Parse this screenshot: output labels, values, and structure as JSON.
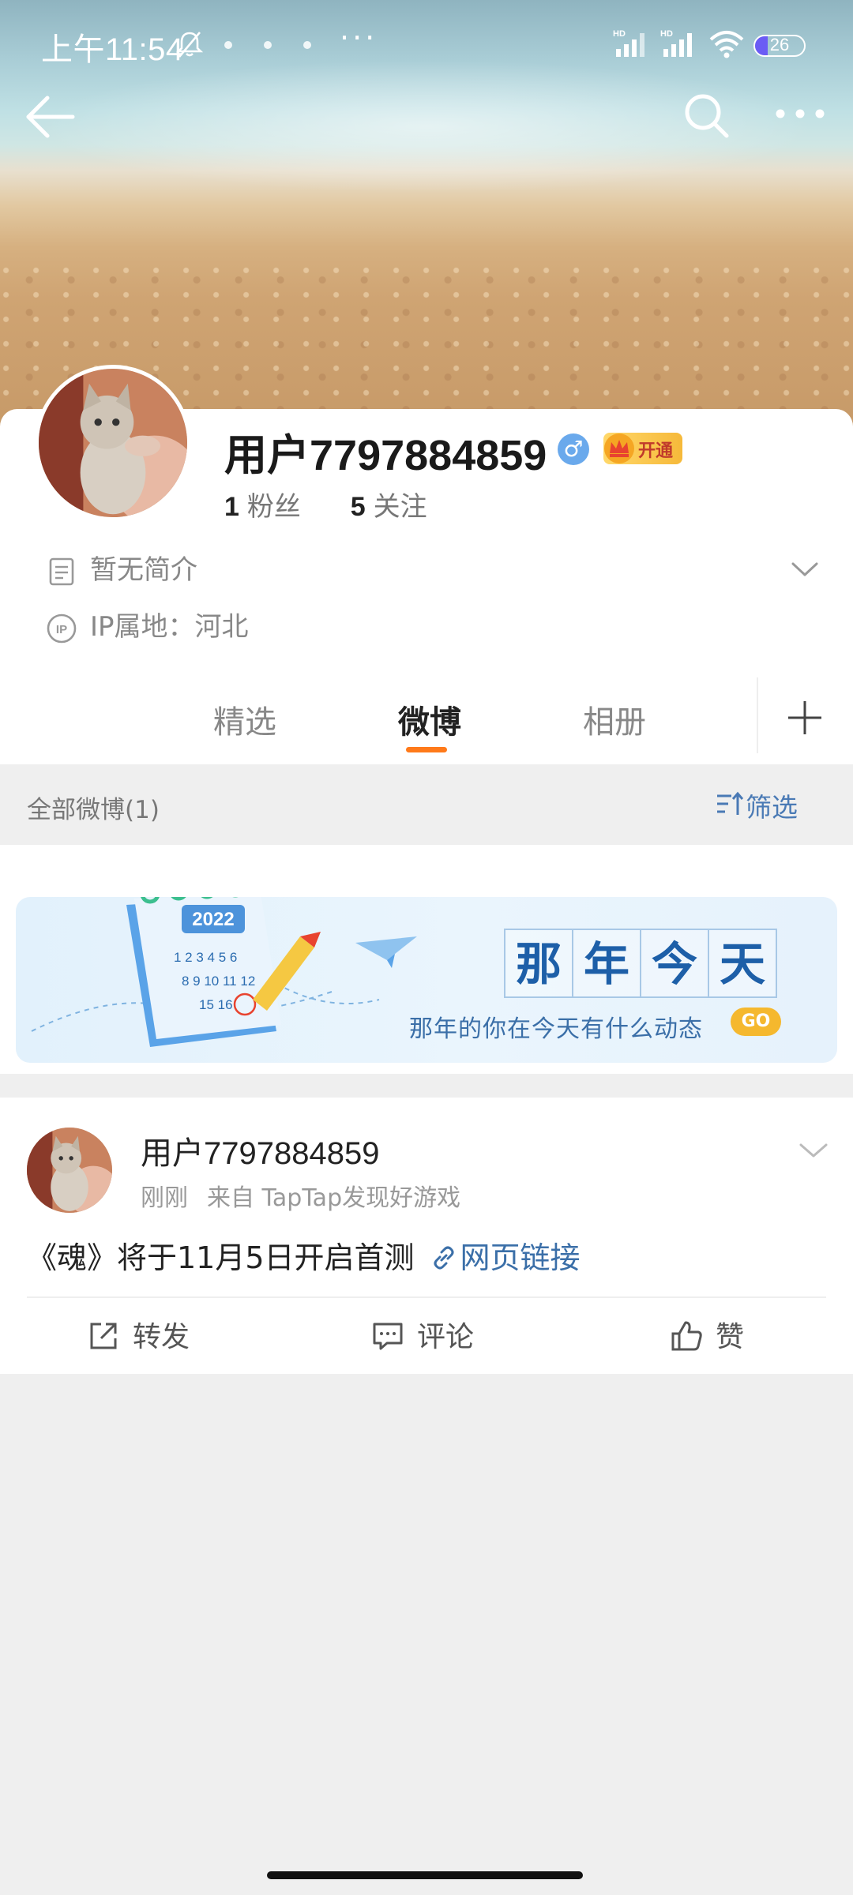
{
  "status_bar": {
    "time": "上午11:54",
    "more": "···",
    "battery": "26",
    "battery_level": 0.26
  },
  "profile": {
    "username": "用户7797884859",
    "gender_symbol": "♂",
    "vip_label": "开通",
    "fans_count": "1",
    "fans_label": "粉丝",
    "following_count": "5",
    "following_label": "关注",
    "bio": "暂无简介",
    "ip_location": "IP属地：河北"
  },
  "tabs": [
    {
      "label": "精选",
      "active": false
    },
    {
      "label": "微博",
      "active": true
    },
    {
      "label": "相册",
      "active": false
    }
  ],
  "filter_bar": {
    "title": "全部微博(1)",
    "filter_label": "筛选"
  },
  "promo": {
    "title_chars": [
      "那",
      "年",
      "今",
      "天"
    ],
    "subtitle": "那年的你在今天有什么动态",
    "go_label": "GO"
  },
  "post": {
    "username": "用户7797884859",
    "time": "刚刚",
    "source": "来自 TapTap发现好游戏",
    "text": "《魂》将于11月5日开启首测",
    "link_label": "网页链接",
    "actions": {
      "repost": "转发",
      "comment": "评论",
      "like": "赞"
    }
  },
  "colors": {
    "accent_orange": "#ff7a1a",
    "link_blue": "#3b6fa8",
    "vip_gold": "#f6b93a"
  }
}
